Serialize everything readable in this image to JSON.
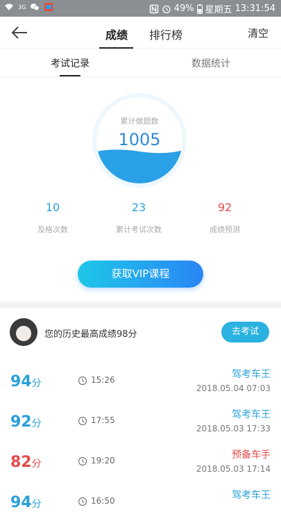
{
  "status_bar": {
    "battery": "49%",
    "day": "星期五",
    "time": "13:31:54",
    "network": "3G"
  },
  "nav": {
    "tabs": [
      "成绩",
      "排行榜"
    ],
    "active_tab": 0,
    "clear_label": "清空"
  },
  "subtabs": {
    "items": [
      "考试记录",
      "数据统计"
    ],
    "active": 0
  },
  "gauge": {
    "label": "累计做题数",
    "value": "1005"
  },
  "stats": [
    {
      "value": "10",
      "label": "及格次数",
      "color": "#2aa0d8"
    },
    {
      "value": "23",
      "label": "累计考试次数",
      "color": "#2aa0d8"
    },
    {
      "value": "92",
      "label": "成绩预测",
      "color": "#e24c4c"
    }
  ],
  "vip_button": "获取VIP课程",
  "history": {
    "best_text": "您的历史最高成绩98分",
    "go_exam_label": "去考试"
  },
  "records": [
    {
      "score": "94",
      "unit": "分",
      "duration": "15:26",
      "level": "驾考车王",
      "date": "2018.05.04  07:03",
      "color": "blue"
    },
    {
      "score": "92",
      "unit": "分",
      "duration": "17:55",
      "level": "驾考车王",
      "date": "2018.05.03  17:33",
      "color": "blue"
    },
    {
      "score": "82",
      "unit": "分",
      "duration": "19:20",
      "level": "预备车手",
      "date": "2018.05.03  17:14",
      "color": "red"
    },
    {
      "score": "94",
      "unit": "分",
      "duration": "16:50",
      "level": "驾考车王",
      "date": "",
      "color": "blue"
    }
  ],
  "colors": {
    "accent_blue": "#2aa0d8",
    "accent_red": "#e24c4c",
    "vip_gradient_start": "#1ec7e8",
    "vip_gradient_end": "#2a86f5"
  }
}
